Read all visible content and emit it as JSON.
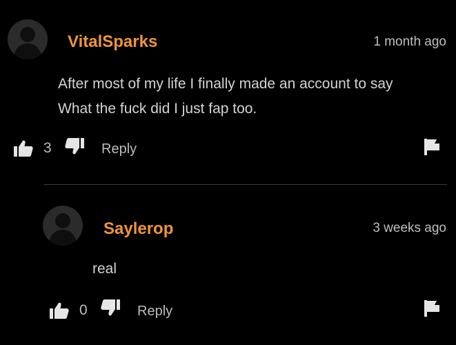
{
  "comments": [
    {
      "username": "VitalSparks",
      "timestamp": "1 month ago",
      "text_lines": [
        "After most of my life I finally made an account to say",
        "What the fuck did I just fap too."
      ],
      "likes": "3",
      "reply_label": "Reply",
      "avatar_icon": "user-silhouette-icon",
      "like_icon": "thumbs-up-icon",
      "dislike_icon": "thumbs-down-icon",
      "flag_icon": "flag-icon"
    },
    {
      "username": "Saylerop",
      "timestamp": "3 weeks ago",
      "text_lines": [
        "real"
      ],
      "likes": "0",
      "reply_label": "Reply",
      "avatar_icon": "user-silhouette-icon",
      "like_icon": "thumbs-up-icon",
      "dislike_icon": "thumbs-down-icon",
      "flag_icon": "flag-icon"
    }
  ],
  "colors": {
    "background": "#000000",
    "username": "#f0943a",
    "text": "#d4d4d4",
    "muted": "#bdbdbd",
    "divider": "#3a3a3a"
  }
}
